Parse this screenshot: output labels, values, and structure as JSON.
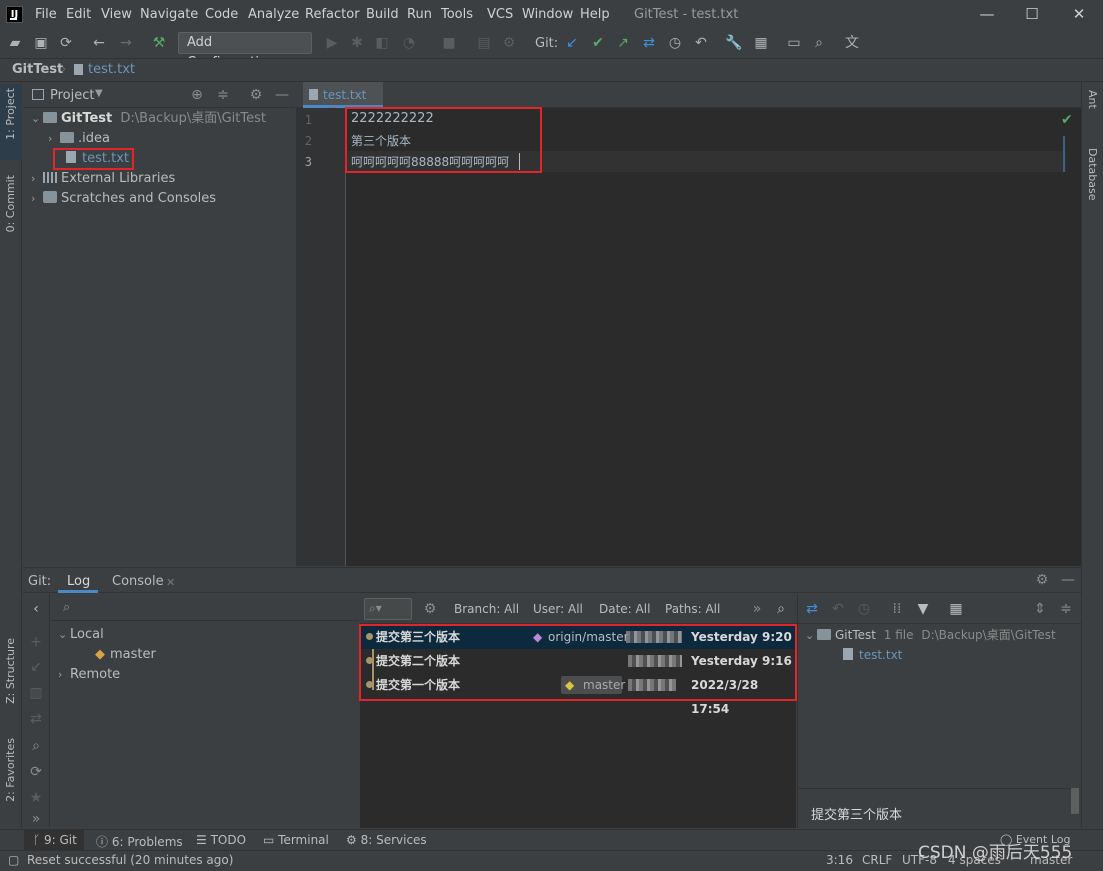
{
  "menubar": {
    "items": [
      "File",
      "Edit",
      "View",
      "Navigate",
      "Code",
      "Analyze",
      "Refactor",
      "Build",
      "Run",
      "Tools",
      "VCS",
      "Window",
      "Help"
    ],
    "title": "GitTest - test.txt"
  },
  "toolbar": {
    "add_config_label": "Add Configuration...",
    "git_label": "Git:"
  },
  "breadcrumb": {
    "project": "GitTest",
    "file": "test.txt"
  },
  "left_stripe": {
    "project_tab": "1: Project",
    "commit_tab": "0: Commit",
    "structure_tab": "Z: Structure",
    "favorites_tab": "2: Favorites"
  },
  "right_stripe": {
    "ant_tab": "Ant",
    "database_tab": "Database"
  },
  "project_panel": {
    "header_label": "Project",
    "root_name": "GitTest",
    "root_path": "D:\\Backup\\桌面\\GitTest",
    "items": [
      ".idea",
      "test.txt",
      "External Libraries",
      "Scratches and Consoles"
    ]
  },
  "editor": {
    "tab_label": "test.txt",
    "lines": [
      "2222222222",
      "第三个版本",
      "呵呵呵呵呵88888呵呵呵呵呵"
    ],
    "line_numbers": [
      "1",
      "2",
      "3"
    ]
  },
  "bottom_panel": {
    "git_label": "Git:",
    "tabs": [
      "Log",
      "Console"
    ],
    "branches": {
      "local_label": "Local",
      "master_label": "master",
      "remote_label": "Remote"
    },
    "filters": {
      "branch": "Branch: All",
      "user": "User: All",
      "date": "Date: All",
      "paths": "Paths: All"
    },
    "commits": [
      {
        "message": "提交第三个版本",
        "ref": "origin/master",
        "date": "Yesterday 9:20",
        "selected": true
      },
      {
        "message": "提交第二个版本",
        "ref": "",
        "date": "Yesterday 9:16",
        "selected": false
      },
      {
        "message": "提交第一个版本",
        "ref": "master",
        "date": "2022/3/28 17:54",
        "selected": false
      }
    ],
    "details": {
      "root_name": "GitTest",
      "file_count": "1 file",
      "root_path": "D:\\Backup\\桌面\\GitTest",
      "file_name": "test.txt",
      "commit_message": "提交第三个版本"
    }
  },
  "tool_tabs": [
    "9: Git",
    "6: Problems",
    "TODO",
    "Terminal",
    "8: Services"
  ],
  "status_bar": {
    "message": "Reset successful (20 minutes ago)",
    "position": "3:16",
    "line_sep": "CRLF",
    "encoding": "UTF-8",
    "indent": "4 spaces",
    "branch": "master",
    "event_log": "Event Log",
    "watermark": "CSDN @雨后天555"
  },
  "colors": {
    "accent": "#4a88c7",
    "highlight_box": "#e0262a",
    "selected_row": "#0d293e"
  }
}
